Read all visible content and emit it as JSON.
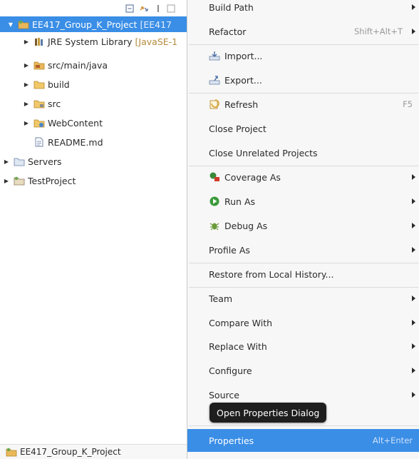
{
  "explorer": {
    "tree": [
      {
        "label": "EE417_Group_K_Project",
        "decoration": "[EE417",
        "icon": "project-icon",
        "expanded": true,
        "selected": true
      },
      {
        "label": "JRE System Library",
        "decoration": "[JavaSE-1",
        "icon": "library-icon",
        "expanded": false
      },
      {
        "label": "src/main/java",
        "icon": "source-folder-icon",
        "expanded": false
      },
      {
        "label": "build",
        "icon": "folder-icon",
        "expanded": false
      },
      {
        "label": "src",
        "icon": "folder-icon",
        "expanded": false
      },
      {
        "label": "WebContent",
        "icon": "folder-icon",
        "expanded": false
      },
      {
        "label": "README.md",
        "icon": "file-icon"
      },
      {
        "label": "Servers",
        "icon": "servers-folder-icon",
        "expanded": false
      },
      {
        "label": "TestProject",
        "icon": "project-icon",
        "expanded": false
      }
    ],
    "status_label": "EE417_Group_K_Project"
  },
  "context_menu": {
    "items": [
      {
        "label": "Build Path",
        "submenu": true
      },
      {
        "label": "Refactor",
        "accelerator": "Shift+Alt+T",
        "submenu": true
      },
      {
        "label": "Import...",
        "icon": "import-icon"
      },
      {
        "label": "Export...",
        "icon": "export-icon"
      },
      {
        "label": "Refresh",
        "icon": "refresh-icon",
        "accelerator": "F5"
      },
      {
        "label": "Close Project"
      },
      {
        "label": "Close Unrelated Projects"
      },
      {
        "label": "Coverage As",
        "icon": "coverage-icon",
        "submenu": true
      },
      {
        "label": "Run As",
        "icon": "run-icon",
        "submenu": true
      },
      {
        "label": "Debug As",
        "icon": "debug-icon",
        "submenu": true
      },
      {
        "label": "Profile As",
        "submenu": true
      },
      {
        "label": "Restore from Local History..."
      },
      {
        "label": "Team",
        "submenu": true
      },
      {
        "label": "Compare With",
        "submenu": true
      },
      {
        "label": "Replace With",
        "submenu": true
      },
      {
        "label": "Configure",
        "submenu": true
      },
      {
        "label": "Source",
        "submenu": true
      },
      {
        "label": "Properties",
        "accelerator": "Alt+Enter",
        "highlighted": true
      }
    ]
  },
  "tooltip": {
    "text": "Open Properties Dialog"
  },
  "colors": {
    "selection": "#3a8ee6",
    "tooltip_bg": "#1e1e1e",
    "menu_bg": "#f7f7f7"
  }
}
